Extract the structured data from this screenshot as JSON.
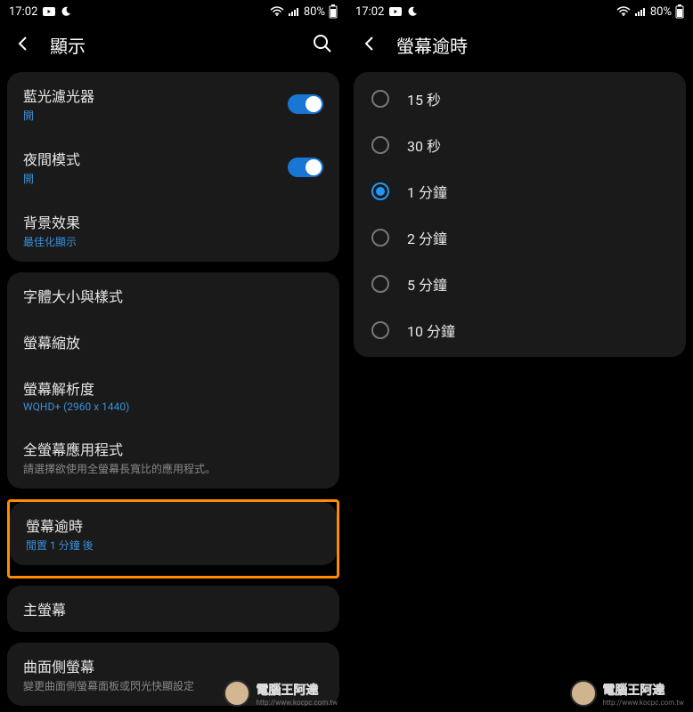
{
  "status": {
    "time": "17:02",
    "battery": "80%"
  },
  "left": {
    "title": "顯示",
    "groups": [
      {
        "items": [
          {
            "title_key": "blue_light",
            "title": "藍光濾光器",
            "sub": "開",
            "sub_class": "blue",
            "toggle": true
          },
          {
            "title_key": "night_mode",
            "title": "夜間模式",
            "sub": "開",
            "sub_class": "blue",
            "toggle": true
          },
          {
            "title_key": "bg_effect",
            "title": "背景效果",
            "sub": "最佳化顯示",
            "sub_class": "blue"
          }
        ]
      },
      {
        "items": [
          {
            "title_key": "font",
            "title": "字體大小與樣式"
          },
          {
            "title_key": "zoom",
            "title": "螢幕縮放"
          },
          {
            "title_key": "resolution",
            "title": "螢幕解析度",
            "sub": "WQHD+ (2960 x 1440)",
            "sub_class": "blue"
          },
          {
            "title_key": "fullscreen",
            "title": "全螢幕應用程式",
            "sub": "請選擇欲使用全螢幕長寬比的應用程式。",
            "sub_class": "gray"
          }
        ]
      },
      {
        "highlighted": true,
        "items": [
          {
            "title_key": "timeout",
            "title": "螢幕逾時",
            "sub": "閒置 1 分鐘 後",
            "sub_class": "blue"
          }
        ]
      },
      {
        "items": [
          {
            "title_key": "home",
            "title": "主螢幕"
          }
        ]
      },
      {
        "items": [
          {
            "title_key": "edge",
            "title": "曲面側螢幕",
            "sub": "變更曲面側螢幕面板或閃光快顯設定",
            "sub_class": "gray"
          }
        ]
      }
    ]
  },
  "right": {
    "title": "螢幕逾時",
    "options": [
      {
        "label": "15 秒",
        "selected": false
      },
      {
        "label": "30 秒",
        "selected": false
      },
      {
        "label": "1 分鐘",
        "selected": true
      },
      {
        "label": "2 分鐘",
        "selected": false
      },
      {
        "label": "5 分鐘",
        "selected": false
      },
      {
        "label": "10 分鐘",
        "selected": false
      }
    ]
  },
  "watermark": {
    "text": "電腦王阿達",
    "url": "http://www.kocpc.com.tw"
  }
}
